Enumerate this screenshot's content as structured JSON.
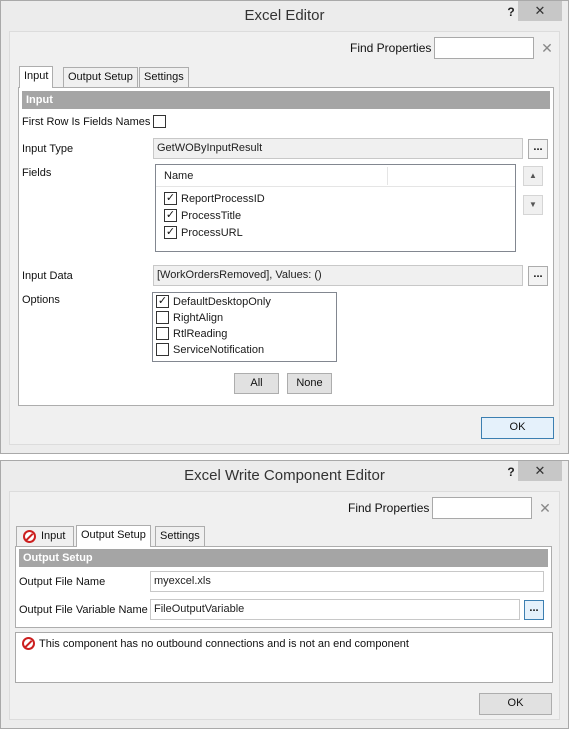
{
  "window1": {
    "title": "Excel Editor",
    "help_label": "?",
    "close_label": "✕",
    "find_properties_label": "Find Properties",
    "find_properties_value": "",
    "clear_label": "✕",
    "tabs": [
      {
        "label": "Input"
      },
      {
        "label": "Output Setup"
      },
      {
        "label": "Settings"
      }
    ],
    "section_header": "Input",
    "first_row_label": "First Row Is Fields Names",
    "first_row_checked": false,
    "input_type_label": "Input Type",
    "input_type_value": "GetWOByInputResult",
    "fields_label": "Fields",
    "fields_column_header": "Name",
    "fields": [
      {
        "name": "ReportProcessID",
        "check": "✓"
      },
      {
        "name": "ProcessTitle",
        "check": "✓"
      },
      {
        "name": "ProcessURL",
        "check": "✓"
      }
    ],
    "move_up_label": "▲",
    "move_down_label": "▼",
    "input_data_label": "Input Data",
    "input_data_value": "[WorkOrdersRemoved], Values: ()",
    "ellipsis_label": "...",
    "options_label": "Options",
    "options": [
      {
        "name": "DefaultDesktopOnly",
        "check": "✓"
      },
      {
        "name": "RightAlign",
        "check": ""
      },
      {
        "name": "RtlReading",
        "check": ""
      },
      {
        "name": "ServiceNotification",
        "check": ""
      }
    ],
    "all_button": "All",
    "none_button": "None",
    "ok_button": "OK"
  },
  "window2": {
    "title": "Excel Write Component Editor",
    "help_label": "?",
    "close_label": "✕",
    "find_properties_label": "Find Properties",
    "find_properties_value": "",
    "clear_label": "✕",
    "tabs": [
      {
        "label": "Input",
        "has_error_icon": true
      },
      {
        "label": "Output Setup"
      },
      {
        "label": "Settings"
      }
    ],
    "section_header": "Output Setup",
    "output_file_name_label": "Output File Name",
    "output_file_name_value": "myexcel.xls",
    "output_file_variable_label": "Output File Variable Name",
    "output_file_variable_value": "FileOutputVariable",
    "ellipsis_label": "...",
    "error_message": "This component has no outbound connections and is not an end component",
    "ok_button": "OK"
  },
  "colors": {
    "window_bg": "#ececec",
    "panel_bg": "#ffffff",
    "section_header_bg": "#a5a5a5",
    "error_red": "#cc1f1f",
    "focus_blue": "#3c7fb1"
  },
  "icons": [
    "help-icon",
    "close-icon",
    "clear-icon",
    "error-icon",
    "arrow-up-icon",
    "arrow-down-icon",
    "checkmark-icon"
  ]
}
